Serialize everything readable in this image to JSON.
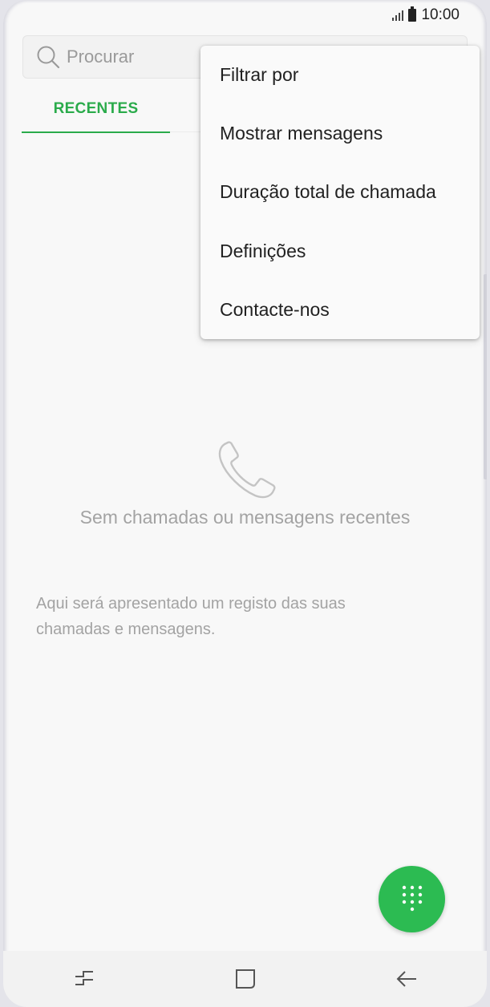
{
  "status_bar": {
    "time": "10:00"
  },
  "search": {
    "placeholder": "Procurar"
  },
  "tabs": [
    {
      "label": "RECENTES"
    }
  ],
  "menu": {
    "items": [
      {
        "label": "Filtrar por"
      },
      {
        "label": "Mostrar mensagens"
      },
      {
        "label": "Duração total de chamada"
      },
      {
        "label": "Definições"
      },
      {
        "label": "Contacte-nos"
      }
    ]
  },
  "empty_state": {
    "icon": "phone-icon",
    "title": "Sem chamadas ou mensagens recentes",
    "description": "Aqui será apresentado um registo das suas chamadas e mensagens."
  },
  "fab": {
    "icon": "dialpad-icon"
  },
  "nav_bar": {
    "icons": [
      "recent-apps-icon",
      "home-icon",
      "back-icon"
    ]
  },
  "colors": {
    "accent": "#2aab4b",
    "fab": "#2cbb52",
    "background": "#f8f8f8"
  }
}
